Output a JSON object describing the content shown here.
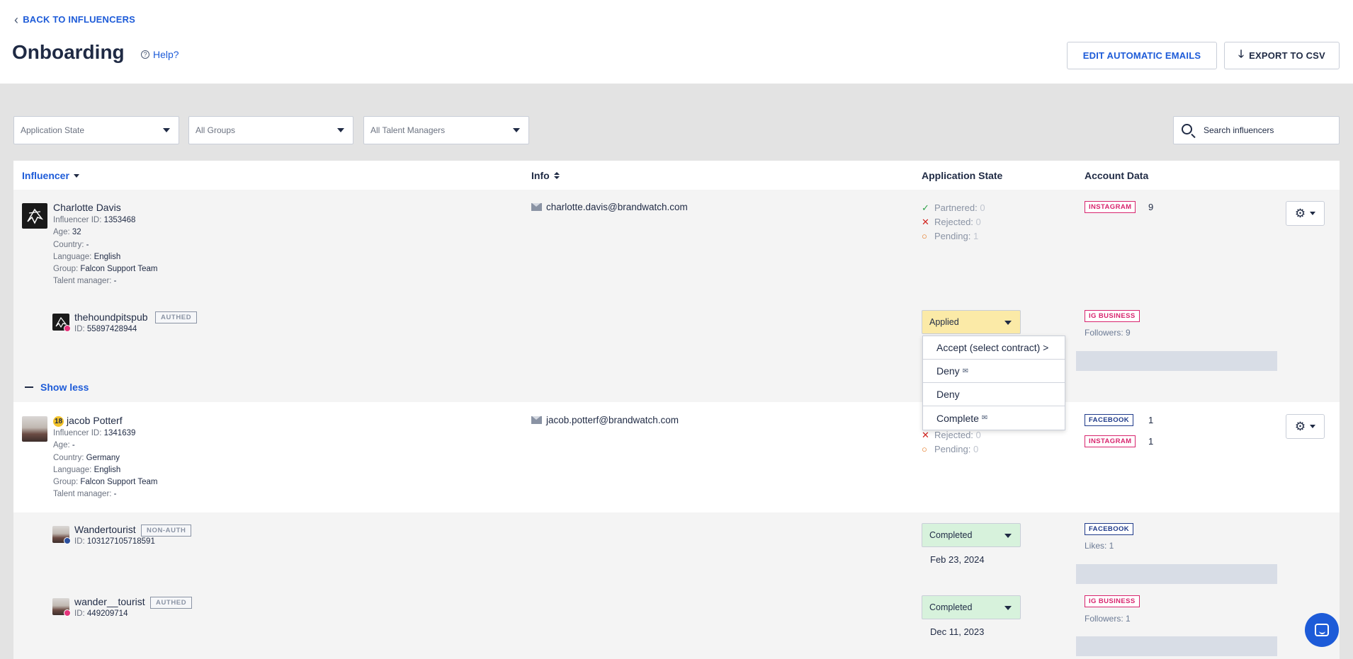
{
  "header": {
    "back_label": "BACK TO INFLUENCERS",
    "title": "Onboarding",
    "help_label": "Help?",
    "edit_emails_label": "EDIT AUTOMATIC EMAILS",
    "export_label": "EXPORT TO CSV"
  },
  "filters": {
    "application_state": "Application State",
    "groups": "All Groups",
    "talent_managers": "All Talent Managers",
    "search_placeholder": "Search influencers"
  },
  "columns": {
    "influencer": "Influencer",
    "info": "Info",
    "application_state": "Application State",
    "account_data": "Account Data"
  },
  "labels": {
    "influencer_id": "Influencer ID:",
    "age": "Age:",
    "country": "Country:",
    "language": "Language:",
    "group": "Group:",
    "talent_manager": "Talent manager:",
    "id": "ID:",
    "partnered": "Partnered:",
    "rejected": "Rejected:",
    "pending": "Pending:",
    "show_less": "Show less"
  },
  "influencers": [
    {
      "name": "Charlotte Davis",
      "influencer_id": "1353468",
      "age": "32",
      "country": "-",
      "language": "English",
      "group": "Falcon Support Team",
      "talent_manager": "-",
      "email": "charlotte.davis@brandwatch.com",
      "partnered": "0",
      "rejected": "0",
      "pending": "1",
      "accounts": [
        {
          "platform": "INSTAGRAM",
          "count": "9"
        }
      ],
      "sub_accounts": [
        {
          "handle": "thehoundpitspub",
          "auth": "AUTHED",
          "id": "55897428944",
          "state": "Applied",
          "platform": "IG BUSINESS",
          "stat": "Followers: 9"
        }
      ]
    },
    {
      "name": "jacob Potterf",
      "badge": "18",
      "influencer_id": "1341639",
      "age": "-",
      "country": "Germany",
      "language": "English",
      "group": "Falcon Support Team",
      "talent_manager": "-",
      "email": "jacob.potterf@brandwatch.com",
      "rejected": "0",
      "pending": "0",
      "accounts": [
        {
          "platform": "FACEBOOK",
          "count": "1"
        },
        {
          "platform": "INSTAGRAM",
          "count": "1"
        }
      ],
      "sub_accounts": [
        {
          "handle": "Wandertourist",
          "auth": "NON-AUTH",
          "id": "103127105718591",
          "state": "Completed",
          "date": "Feb 23, 2024",
          "platform": "FACEBOOK",
          "stat": "Likes: 1"
        },
        {
          "handle": "wander__tourist",
          "auth": "AUTHED",
          "id": "449209714",
          "state": "Completed",
          "date": "Dec 11, 2023",
          "platform": "IG BUSINESS",
          "stat": "Followers: 1"
        }
      ]
    }
  ],
  "state_menu": {
    "items": [
      "Accept (select contract) >",
      "Deny",
      "Deny",
      "Complete"
    ]
  },
  "icons": {
    "back": "chevron-left-icon",
    "help": "question-circle-icon",
    "export": "download-arrow-icon",
    "search": "search-icon",
    "email": "envelope-icon",
    "settings": "gear-icon",
    "chat": "chat-icon"
  },
  "colors": {
    "accent": "#1d5bd8",
    "instagram": "#d8246e",
    "facebook": "#1f3a8a",
    "applied": "#fbeaa7",
    "completed": "#d7f2dc",
    "partnered": "#2fa24a",
    "rejected": "#d1221d",
    "pending": "#e3741b"
  }
}
